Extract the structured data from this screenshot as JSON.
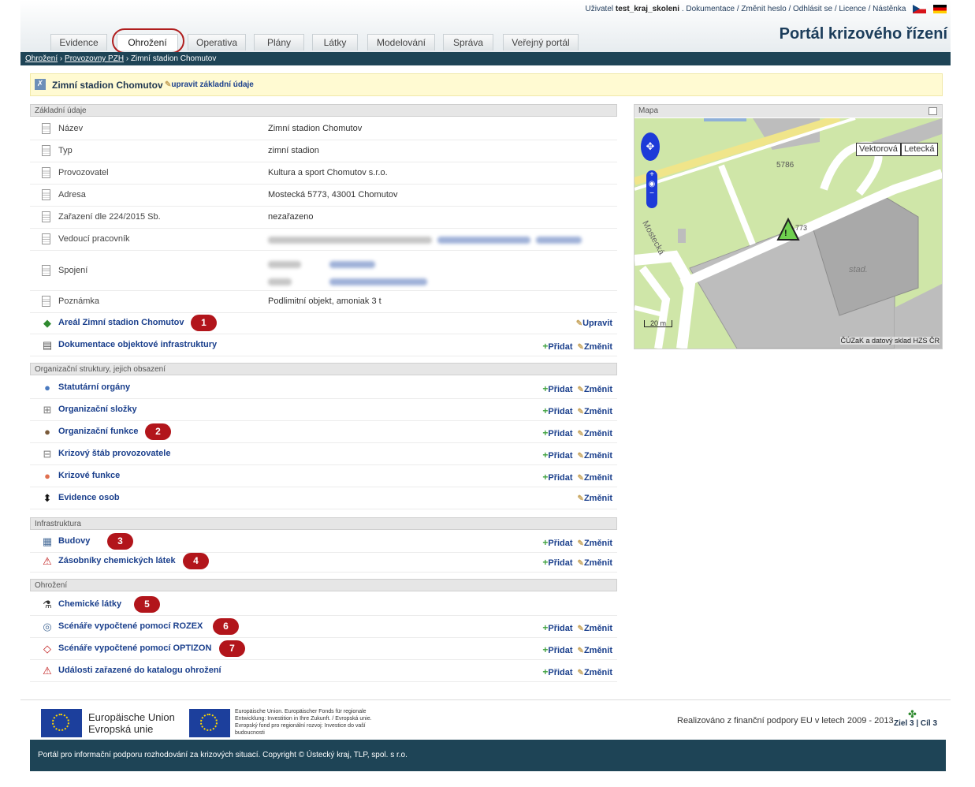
{
  "topbar": {
    "user_prefix": "Uživatel",
    "user_name": "test_kraj_skoleni",
    "links": ". Dokumentace / Změnit heslo / Odhlásit se / Licence / Nástěnka"
  },
  "portal_title": "Portál krizového řízení",
  "tabs": [
    "Evidence",
    "Ohrožení",
    "Operativa",
    "Plány",
    "Látky",
    "Modelování",
    "Správa",
    "Veřejný portál"
  ],
  "active_tab": "Ohrožení",
  "breadcrumb": {
    "a": "Ohrožení",
    "sep1": " › ",
    "b": "Provozovny PZH",
    "sep2": " › ",
    "c": "Zimní stadion Chomutov"
  },
  "object": {
    "name": "Zimní stadion Chomutov",
    "edit_link": "upravit základní údaje"
  },
  "sections": {
    "basic": "Základní údaje",
    "org": "Organizační struktury, jejich obsazení",
    "infra": "Infrastruktura",
    "threat": "Ohrožení"
  },
  "fields": [
    {
      "label": "Název",
      "value": "Zimní stadion Chomutov"
    },
    {
      "label": "Typ",
      "value": "zimní stadion"
    },
    {
      "label": "Provozovatel",
      "value": "Kultura a sport Chomutov s.r.o."
    },
    {
      "label": "Adresa",
      "value": "Mostecká 5773, 43001 Chomutov"
    },
    {
      "label": "Zařazení dle 224/2015 Sb.",
      "value": "nezařazeno"
    },
    {
      "label": "Vedoucí pracovník",
      "value": ""
    },
    {
      "label": "Spojení",
      "value": ""
    },
    {
      "label": "Poznámka",
      "value": "Podlimitní objekt, amoniak 3 t"
    }
  ],
  "actions": {
    "add": "Přidat",
    "change": "Změnit",
    "edit": "Upravit"
  },
  "links_basic": [
    {
      "label": "Areál Zimní stadion Chomutov",
      "badge": "1"
    },
    {
      "label": "Dokumentace objektové infrastruktury"
    }
  ],
  "links_org": [
    {
      "label": "Statutární orgány"
    },
    {
      "label": "Organizační složky"
    },
    {
      "label": "Organizační funkce",
      "badge": "2"
    },
    {
      "label": "Krizový štáb provozovatele"
    },
    {
      "label": "Krizové funkce"
    },
    {
      "label": "Evidence osob"
    }
  ],
  "links_infra": [
    {
      "label": "Budovy",
      "badge": "3"
    },
    {
      "label": "Zásobníky chemických látek",
      "badge": "4"
    }
  ],
  "links_threat": [
    {
      "label": "Chemické látky",
      "badge": "5"
    },
    {
      "label": "Scénáře vypočtené pomocí ROZEX",
      "badge": "6"
    },
    {
      "label": "Scénáře vypočtené pomocí OPTIZON",
      "badge": "7"
    },
    {
      "label": "Události zařazené do katalogu ohrožení"
    }
  ],
  "map": {
    "title": "Mapa",
    "btn_vector": "Vektorová",
    "btn_aerial": "Letecká",
    "label_5786": "5786",
    "label_773": "773",
    "label_street": "Mostecká",
    "label_stad": "stad.",
    "scale": "20 m",
    "attribution": "ČÚZaK a datový sklad HZS ČR"
  },
  "footer": {
    "eu_title_de": "Europäische Union",
    "eu_title_cz": "Evropská unie",
    "eu_fund_text": "Europäische Union. Europäischer Fonds für regionale Entwicklung: Investition in Ihre Zukunft. / Evropská unie. Evropský fond pro regionální rozvoj: Investice do vaší budoucnosti",
    "funding_text": "Realizováno z finanční podpory EU v letech 2009 - 2013",
    "ziel_logo": "Ziel 3 | Cíl 3",
    "copyright": "Portál pro informační podporu rozhodování za krizových situací. Copyright © Ústecký kraj, TLP, spol. s r.o."
  }
}
